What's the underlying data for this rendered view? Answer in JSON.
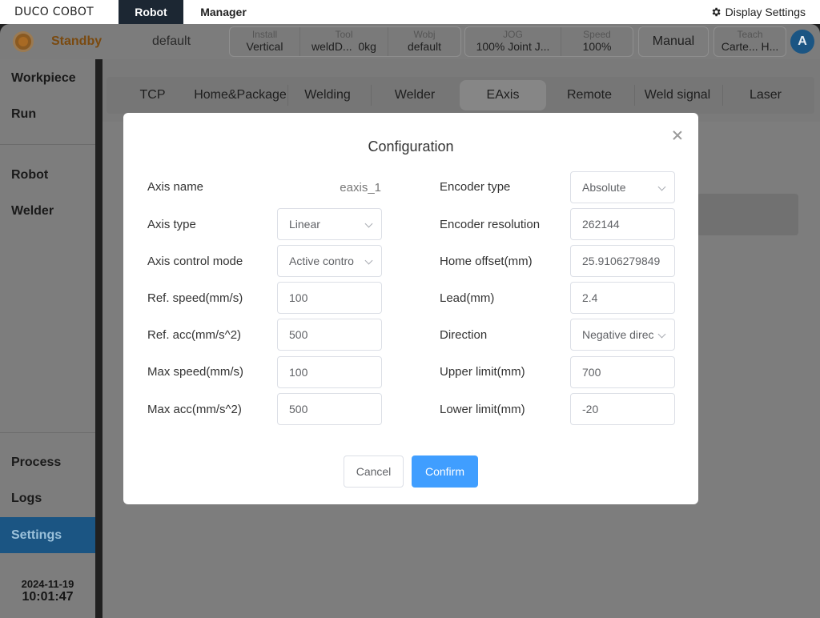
{
  "app": {
    "logo": "DUCO COBOT",
    "tabs": [
      {
        "label": "Robot"
      },
      {
        "label": "Manager"
      }
    ],
    "display_settings": "Display Settings"
  },
  "status": {
    "state": "Standby",
    "program": "default",
    "install": {
      "label": "Install",
      "value": "Vertical"
    },
    "tool": {
      "label": "Tool",
      "value": "weldD...",
      "weight": "0kg"
    },
    "wobj": {
      "label": "Wobj",
      "value": "default"
    },
    "jog": {
      "label": "JOG",
      "value": "100% Joint J..."
    },
    "speed": {
      "label": "Speed",
      "value": "100%"
    },
    "mode": "Manual",
    "teach": {
      "label": "Teach",
      "value": "Carte... H..."
    },
    "avatar": "A"
  },
  "sidebar": {
    "items": [
      {
        "label": "Workpiece"
      },
      {
        "label": "Run"
      },
      {
        "label": "Robot"
      },
      {
        "label": "Welder"
      },
      {
        "label": "Process"
      },
      {
        "label": "Logs"
      },
      {
        "label": "Settings"
      }
    ],
    "date": "2024-11-19",
    "time": "10:01:47"
  },
  "subtabs": [
    {
      "label": "TCP"
    },
    {
      "label": "Home&Package"
    },
    {
      "label": "Welding"
    },
    {
      "label": "Welder"
    },
    {
      "label": "EAxis"
    },
    {
      "label": "Remote"
    },
    {
      "label": "Weld signal"
    },
    {
      "label": "Laser"
    }
  ],
  "modal": {
    "title": "Configuration",
    "left": {
      "axis_name": {
        "label": "Axis name",
        "value": "eaxis_1"
      },
      "axis_type": {
        "label": "Axis type",
        "value": "Linear"
      },
      "axis_control_mode": {
        "label": "Axis control mode",
        "value": "Active contro"
      },
      "ref_speed": {
        "label": "Ref. speed(mm/s)",
        "value": "100"
      },
      "ref_acc": {
        "label": "Ref. acc(mm/s^2)",
        "value": "500"
      },
      "max_speed": {
        "label": "Max speed(mm/s)",
        "value": "100"
      },
      "max_acc": {
        "label": "Max acc(mm/s^2)",
        "value": "500"
      }
    },
    "right": {
      "encoder_type": {
        "label": "Encoder type",
        "value": "Absolute"
      },
      "encoder_resolution": {
        "label": "Encoder resolution",
        "value": "262144"
      },
      "home_offset": {
        "label": "Home offset(mm)",
        "value": "25.9106279849"
      },
      "lead": {
        "label": "Lead(mm)",
        "value": "2.4"
      },
      "direction": {
        "label": "Direction",
        "value": "Negative direc"
      },
      "upper_limit": {
        "label": "Upper limit(mm)",
        "value": "700"
      },
      "lower_limit": {
        "label": "Lower limit(mm)",
        "value": "-20"
      }
    },
    "cancel": "Cancel",
    "confirm": "Confirm"
  },
  "colors": {
    "accent": "#409eff",
    "active_nav": "#1b5583",
    "standby": "#e09a2a"
  }
}
